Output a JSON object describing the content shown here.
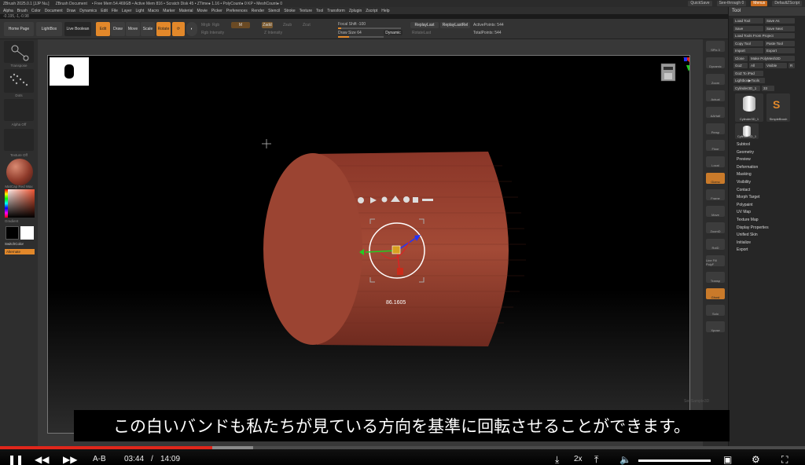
{
  "title_bar": {
    "app": "ZBrush 2025.0.1 [JJP Nu.]",
    "document": "ZBrush Document",
    "stats": "• Free Mem 54.469GB • Active Mem 816 • Scratch Disk 45 • ZTime● 1.16 • PolyCount● 0 KP • MeshCount● 0",
    "quicksave": "QuickSave",
    "see_through": "See-through",
    "see_through_value": "0",
    "menus": "Menus",
    "zscript": "DefaultZScript"
  },
  "menu_bar": [
    "Alpha",
    "Brush",
    "Color",
    "Document",
    "Draw",
    "Dynamics",
    "Edit",
    "File",
    "Layer",
    "Light",
    "Macro",
    "Marker",
    "Material",
    "Movie",
    "Picker",
    "Preferences",
    "Render",
    "Stencil",
    "Stroke",
    "Texture",
    "Tool",
    "Transform",
    "Zplugin",
    "Zscript",
    "Help"
  ],
  "coords": "-0.195,-1,-0.98",
  "toolbar": {
    "home_page": "Home Page",
    "lightbox": "LightBox",
    "live_boolean": "Live Boolean",
    "edit": "Edit",
    "draw": "Draw",
    "move": "Move",
    "scale": "Scale",
    "rotate": "Rotate",
    "mrgb": "Mrgb",
    "rgb": "Rgb",
    "m": "M",
    "zadd": "Zadd",
    "zsub": "Zsub",
    "zcut": "Zcut",
    "rgb_intensity": "Rgb Intensity",
    "z_intensity": "Z Intensity",
    "focal_shift_label": "Focal Shift",
    "focal_shift_value": "-100",
    "draw_size_label": "Draw Size",
    "draw_size_value": "64",
    "dynamic": "Dynamic",
    "replay_last": "ReplayLast",
    "replay_last_rel": "ReplayLastRel",
    "active_points": "ActivePoints: 544",
    "total_points": "TotalPoints: 544",
    "rotate_last": "RotateLast"
  },
  "left_shelf": {
    "brush_label": "Transpose",
    "stroke_label": "Dots",
    "alpha_label": "Alpha Off",
    "texture_label": "Texture Off",
    "material_label": "MatCap Red Wax",
    "gradient_label": "Gradient",
    "switch_color": "SwitchColor",
    "alternate": "Alternate",
    "swatch_colors": {
      "main": "#000000",
      "secondary": "#ffffff",
      "material": "#8e3a2a"
    }
  },
  "right_shelf": [
    "SPix 3",
    "Dynamic",
    "Zoom",
    "Actual",
    "AAHalf",
    "Persp",
    "Floor",
    "Local",
    "Gizmo",
    "Frame",
    "Move",
    "ZoomD",
    "RotD",
    "Line Fill PolyF",
    "Transp",
    "Ghost",
    "Solo",
    "Xpose"
  ],
  "tool_panel": {
    "header": "Tool",
    "buttons": [
      "Load Tool",
      "Save As",
      "Save",
      "Save Next",
      "Load Tools From Project",
      "Copy Tool",
      "Paste Tool",
      "Import",
      "Export",
      "Clone",
      "Make PolyMesh3D",
      "GoZ",
      "All",
      "Visible",
      "R",
      "GoZ To iPad",
      "Lightbox▶Tools",
      "Cylinder3D_1",
      "33",
      "Cylinder3D_1",
      "SimpleBrush",
      "Cylinder3D_1"
    ],
    "menus": [
      "Subtool",
      "Geometry",
      "Preview",
      "Deformation",
      "Masking",
      "Visibility",
      "Contact",
      "Morph Target",
      "Polypaint",
      "UV Map",
      "Texture Map",
      "Display Properties",
      "Unified Skin",
      "Initialize",
      "Export"
    ]
  },
  "viewport": {
    "gizmo_readout": "86.1605",
    "watermark": "SeeSample3D"
  },
  "subtitle": "この白いバンドも私たちが見ている方向を基準に回転させることができます。",
  "player": {
    "ab": "A-B",
    "current_time": "03:44",
    "separator": "/",
    "total_time": "14:09",
    "speed": "2x",
    "progress_fraction": 0.264,
    "buffer_fraction": 0.05
  },
  "colors": {
    "accent": "#e2882a",
    "cylinder": "#9b4432",
    "cylinder_dark": "#7a3024",
    "progress": "#e0261b"
  }
}
